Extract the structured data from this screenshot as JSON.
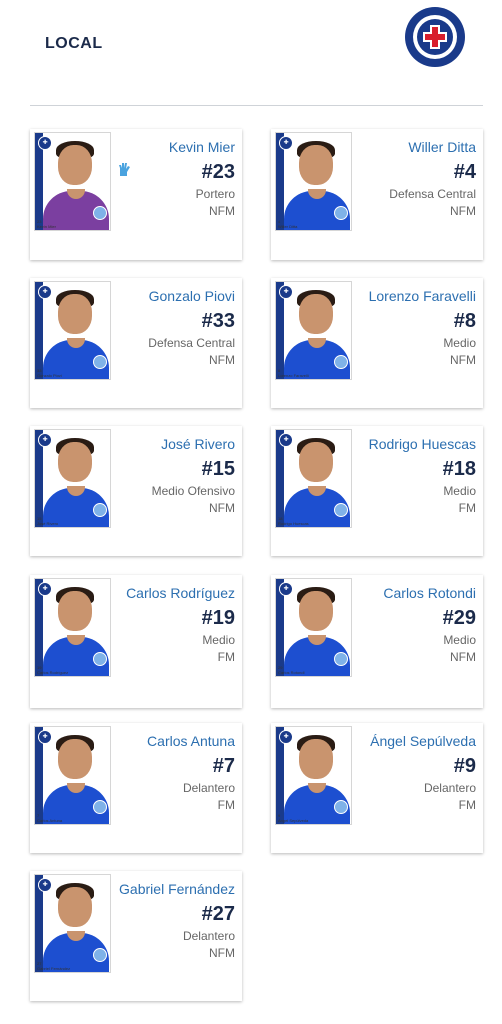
{
  "page": {
    "title": "LOCAL",
    "logo_text": "CRUZ AZUL"
  },
  "players": [
    {
      "name": "Kevin Mier",
      "number": "#23",
      "position": "Portero",
      "status": "NFM",
      "caption": "Kevin Mier",
      "num_small": "23",
      "kit": "goalkeeper"
    },
    {
      "name": "Willer Ditta",
      "number": "#4",
      "position": "Defensa Central",
      "status": "NFM",
      "caption": "Willer Ditta",
      "num_small": "4"
    },
    {
      "name": "Gonzalo Piovi",
      "number": "#33",
      "position": "Defensa Central",
      "status": "NFM",
      "caption": "Gonzalo Piovi",
      "num_small": "33"
    },
    {
      "name": "Lorenzo Faravelli",
      "number": "#8",
      "position": "Medio",
      "status": "NFM",
      "caption": "Lorenzo Faravelli",
      "num_small": "8"
    },
    {
      "name": "José Rivero",
      "number": "#15",
      "position": "Medio Ofensivo",
      "status": "NFM",
      "caption": "José Rivero",
      "num_small": "15"
    },
    {
      "name": "Rodrigo Huescas",
      "number": "#18",
      "position": "Medio",
      "status": "FM",
      "caption": "Rodrigo Huescas",
      "num_small": "18"
    },
    {
      "name": "Carlos Rodríguez",
      "number": "#19",
      "position": "Medio",
      "status": "FM",
      "caption": "Carlos Rodríguez",
      "num_small": "19"
    },
    {
      "name": "Carlos Rotondi",
      "number": "#29",
      "position": "Medio",
      "status": "NFM",
      "caption": "Carlos Rotondi",
      "num_small": "29"
    },
    {
      "name": "Carlos Antuna",
      "number": "#7",
      "position": "Delantero",
      "status": "FM",
      "caption": "Carlos Antuna",
      "num_small": "7"
    },
    {
      "name": "Ángel Sepúlveda",
      "number": "#9",
      "position": "Delantero",
      "status": "FM",
      "caption": "Ángel Sepúlveda",
      "num_small": "9"
    },
    {
      "name": "Gabriel Fernández",
      "number": "#27",
      "position": "Delantero",
      "status": "NFM",
      "caption": "Gabriel Fernández",
      "num_small": "27"
    }
  ],
  "icons": {
    "goalkeeper": "glove-icon",
    "club": "club-crest-icon"
  },
  "colors": {
    "name": "#2c6fb0",
    "number": "#1b2a4a",
    "kit": "#1d4fd0",
    "gk_kit": "#7b3fa0"
  }
}
